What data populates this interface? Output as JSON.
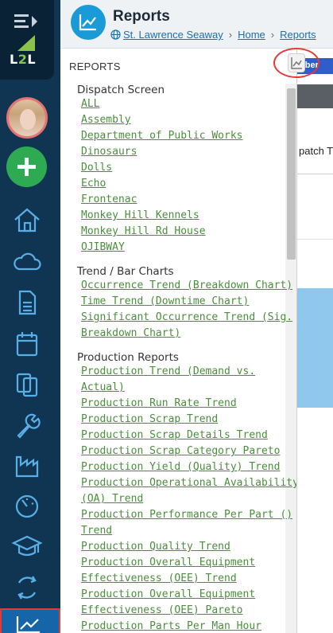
{
  "header": {
    "title": "Reports",
    "breadcrumb": {
      "site": "St. Lawrence Seaway",
      "home": "Home",
      "current": "Reports"
    }
  },
  "sidebar": {
    "logo_text_l": "L",
    "logo_text_2": "2",
    "logo_text_l2": "L",
    "nav": [
      "home-icon",
      "cloud-icon",
      "document-icon",
      "calendar-icon",
      "clipboard-icon",
      "wrench-icon",
      "factory-icon",
      "gauge-icon",
      "graduation-cap-icon",
      "sync-icon",
      "chart-icon"
    ]
  },
  "panel": {
    "heading": "REPORTS",
    "sections": [
      {
        "title": "Dispatch Screen",
        "links": [
          "ALL",
          "Assembly",
          "Department of Public Works",
          "Dinosaurs",
          "Dolls",
          "Echo",
          "Frontenac",
          "Monkey Hill Kennels",
          "Monkey Hill Rd House",
          "OJIBWAY"
        ]
      },
      {
        "title": "Trend / Bar Charts",
        "links": [
          "Occurrence Trend (Breakdown Chart)",
          "Time Trend (Downtime Chart)",
          "Significant Occurrence Trend (Sig.",
          "Breakdown Chart)"
        ]
      },
      {
        "title": "Production Reports",
        "links": [
          "Production Trend (Demand vs.",
          "Actual)",
          "Production Run Rate Trend",
          "Production Scrap Trend",
          "Production Scrap Details Trend",
          "Production Scrap Category Pareto",
          "Production Yield (Quality) Trend",
          "Production Operational Availability",
          "(OA) Trend",
          "Production Performance Per Part ()",
          "Trend",
          "Production Quality Trend",
          "Production Overall Equipment",
          "Effectiveness (OEE) Trend",
          "Production Overall Equipment",
          "Effectiveness (OEE) Pareto",
          "Production Parts Per Man Hour"
        ]
      }
    ]
  },
  "background": {
    "member_button": "mber",
    "column_text": "patch T"
  },
  "colors": {
    "sidebar": "#0f3553",
    "link": "#4a8e3c",
    "accent": "#1a9bd7",
    "add_button": "#2eaa52",
    "highlight": "#e53935"
  }
}
